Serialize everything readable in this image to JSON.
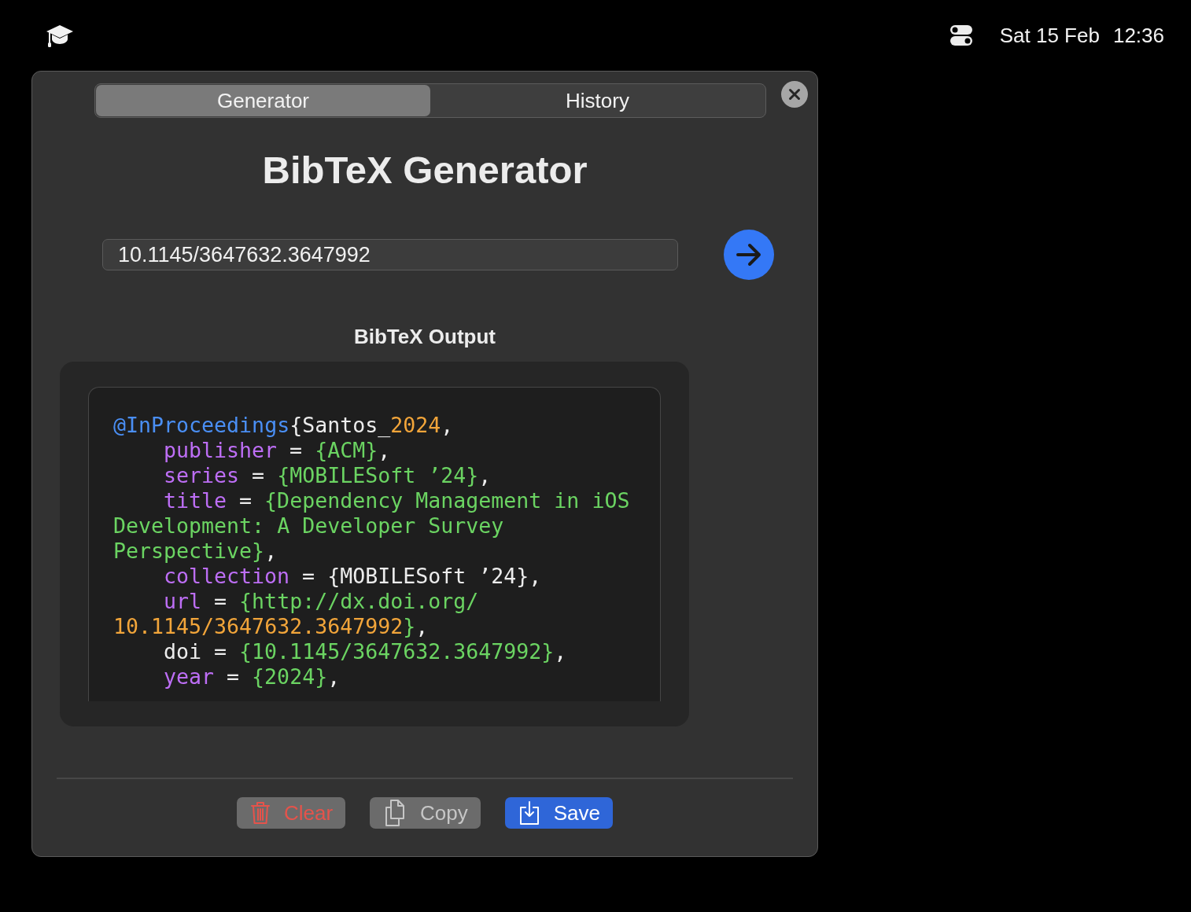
{
  "menu_bar": {
    "date": "Sat 15 Feb",
    "time": "12:36"
  },
  "tabs": [
    {
      "label": "Generator",
      "selected": true
    },
    {
      "label": "History",
      "selected": false
    }
  ],
  "title": "BibTeX Generator",
  "doi_field": {
    "value": "10.1145/3647632.3647992"
  },
  "output": {
    "heading": "BibTeX Output",
    "lines": [
      {
        "kind": "header",
        "tokens": [
          {
            "text": "@InProceedings",
            "kind": "type"
          },
          {
            "text": "{Santos_",
            "kind": "plain"
          },
          {
            "text": "2024",
            "kind": "number"
          },
          {
            "text": ",",
            "kind": "plain"
          }
        ]
      },
      {
        "kind": "field",
        "tokens": [
          {
            "text": "publisher",
            "kind": "field"
          },
          {
            "text": " = ",
            "kind": "plain"
          },
          {
            "text": "{ACM}",
            "kind": "value"
          },
          {
            "text": ",",
            "kind": "plain"
          }
        ]
      },
      {
        "kind": "field",
        "tokens": [
          {
            "text": "series",
            "kind": "field"
          },
          {
            "text": " = ",
            "kind": "plain"
          },
          {
            "text": "{MOBILESoft ’24}",
            "kind": "value"
          },
          {
            "text": ",",
            "kind": "plain"
          }
        ]
      },
      {
        "kind": "field",
        "tokens": [
          {
            "text": "title",
            "kind": "field"
          },
          {
            "text": " = ",
            "kind": "plain"
          },
          {
            "text": "{Dependency Management in iOS",
            "kind": "value"
          }
        ]
      },
      {
        "kind": "wrap",
        "tokens": [
          {
            "text": "Development: A Developer Survey",
            "kind": "value"
          }
        ]
      },
      {
        "kind": "wrap",
        "tokens": [
          {
            "text": "Perspective}",
            "kind": "value"
          },
          {
            "text": ",",
            "kind": "plain"
          }
        ]
      },
      {
        "kind": "field",
        "tokens": [
          {
            "text": "collection",
            "kind": "field"
          },
          {
            "text": " = {MOBILESoft ’24},",
            "kind": "plain"
          }
        ]
      },
      {
        "kind": "field",
        "tokens": [
          {
            "text": "url",
            "kind": "field"
          },
          {
            "text": " = ",
            "kind": "plain"
          },
          {
            "text": "{http://dx.doi.org/",
            "kind": "value"
          }
        ]
      },
      {
        "kind": "wrap",
        "tokens": [
          {
            "text": "10.1145/3647632.3647992",
            "kind": "number"
          },
          {
            "text": "}",
            "kind": "value"
          },
          {
            "text": ",",
            "kind": "plain"
          }
        ]
      },
      {
        "kind": "field",
        "tokens": [
          {
            "text": "doi = ",
            "kind": "plain"
          },
          {
            "text": "{10.1145/3647632.3647992}",
            "kind": "value"
          },
          {
            "text": ",",
            "kind": "plain"
          }
        ]
      },
      {
        "kind": "field",
        "tokens": [
          {
            "text": "year",
            "kind": "field"
          },
          {
            "text": " = ",
            "kind": "plain"
          },
          {
            "text": "{2024}",
            "kind": "value"
          },
          {
            "text": ",",
            "kind": "plain"
          }
        ]
      }
    ]
  },
  "buttons": [
    {
      "label": "Clear",
      "kind": "destructive"
    },
    {
      "label": "Copy",
      "kind": "secondary"
    },
    {
      "label": "Save",
      "kind": "primary"
    }
  ]
}
